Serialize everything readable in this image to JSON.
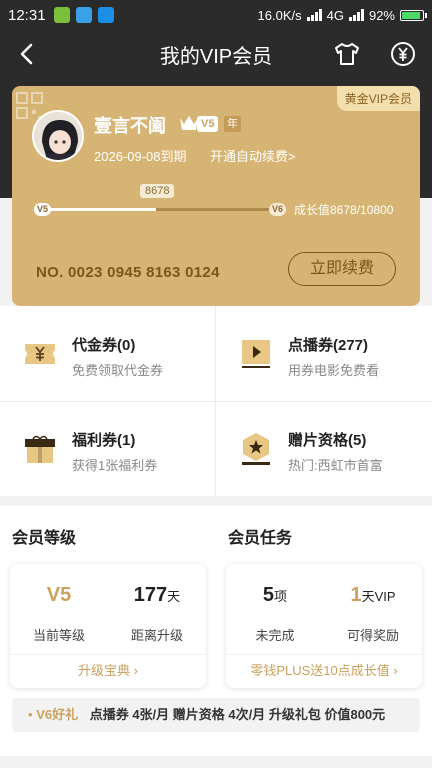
{
  "status_bar": {
    "time": "12:31",
    "net_speed": "16.0K/s",
    "network": "4G",
    "battery": "92%",
    "battery_level": 0.92
  },
  "header": {
    "title": "我的VIP会员",
    "icons": [
      "back-arrow-icon",
      "tshirt-icon",
      "yuan-coin-icon"
    ]
  },
  "card": {
    "level_tag": "黄金VIP会员",
    "username": "壹言不阖",
    "vip_level": "V5",
    "vip_year_label": "年",
    "expire": "2026-09-08到期",
    "auto_renew": "开通自动续费>",
    "progress": {
      "start_level": "V5",
      "end_level": "V6",
      "current": 8678,
      "current_label": "8678",
      "total": 10800,
      "growth_text": "成长值8678/10800"
    },
    "card_number": "NO. 0023 0945 8163 0124",
    "renew_button": "立即续费"
  },
  "coupons": [
    {
      "title": "代金券(0)",
      "subtitle": "免费领取代金券",
      "icon": "cash-ticket-icon"
    },
    {
      "title": "点播券(277)",
      "subtitle": "用券电影免费看",
      "icon": "play-ticket-icon"
    },
    {
      "title": "福利券(1)",
      "subtitle": "获得1张福利券",
      "icon": "gift-box-icon"
    },
    {
      "title": "赠片资格(5)",
      "subtitle": "热门:西虹市首富",
      "icon": "star-hexagon-icon"
    }
  ],
  "member_level": {
    "title": "会员等级",
    "current_level": "V5",
    "current_level_label": "当前等级",
    "days_to_upgrade": "177",
    "days_unit": "天",
    "days_label": "距离升级",
    "link": "升级宝典 ›"
  },
  "member_tasks": {
    "title": "会员任务",
    "incomplete": "5",
    "incomplete_unit": "项",
    "incomplete_label": "未完成",
    "reward": "1",
    "reward_unit": "天VIP",
    "reward_label": "可得奖励",
    "link": "零钱PLUS送10点成长值 ›"
  },
  "benefit_bar": {
    "dot": "•",
    "label": "V6好礼",
    "text": "点播券 4张/月  赠片资格 4次/月  升级礼包 价值800元"
  },
  "colors": {
    "dark": "#2b2b2b",
    "gold_card": "#d6b473",
    "gold_text": "#caa15e",
    "brown_text": "#7c571c"
  }
}
